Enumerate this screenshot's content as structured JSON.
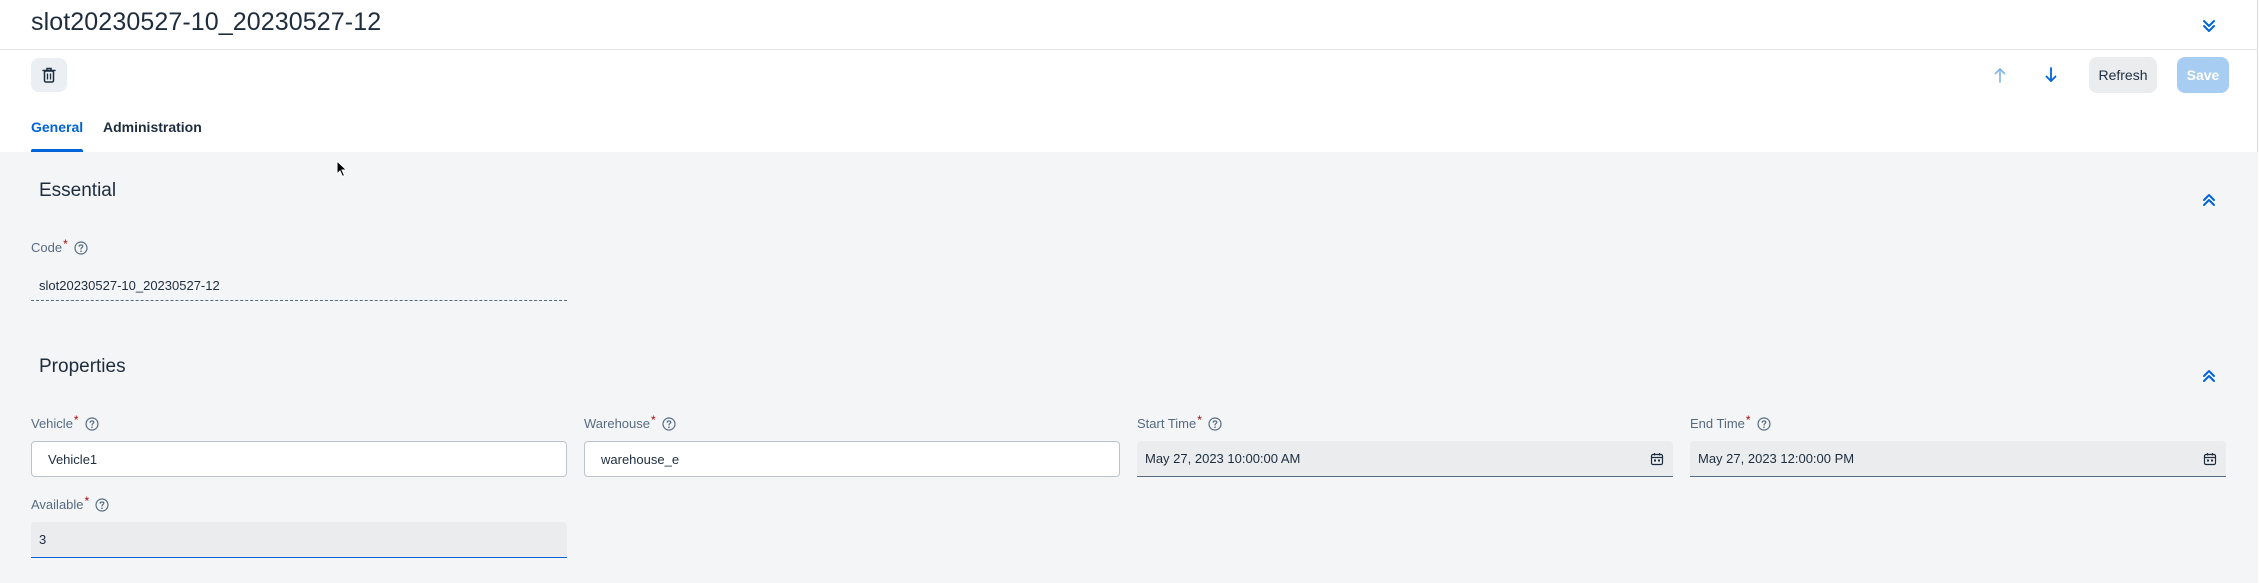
{
  "header": {
    "title": "slot20230527-10_20230527-12",
    "refresh_label": "Refresh",
    "save_label": "Save"
  },
  "tabs": [
    {
      "label": "General",
      "active": true
    },
    {
      "label": "Administration",
      "active": false
    }
  ],
  "essential": {
    "title": "Essential",
    "code": {
      "label": "Code",
      "value": "slot20230527-10_20230527-12"
    }
  },
  "properties": {
    "title": "Properties",
    "vehicle": {
      "label": "Vehicle",
      "value": "Vehicle1"
    },
    "warehouse": {
      "label": "Warehouse",
      "value": "warehouse_e"
    },
    "start_time": {
      "label": "Start Time",
      "value": "May 27, 2023 10:00:00 AM"
    },
    "end_time": {
      "label": "End Time",
      "value": "May 27, 2023 12:00:00 PM"
    },
    "available": {
      "label": "Available",
      "value": "3"
    }
  },
  "required_marker": "*",
  "colors": {
    "accent": "#0064d9",
    "required": "#aa0808",
    "save_disabled": "#a8cdf2",
    "background": "#f4f5f6"
  },
  "icons": [
    "collapse-header-icon",
    "trash-icon",
    "arrow-up-icon",
    "arrow-down-icon",
    "collapse-section-icon",
    "help-icon",
    "calendar-icon",
    "mouse-cursor-icon"
  ]
}
